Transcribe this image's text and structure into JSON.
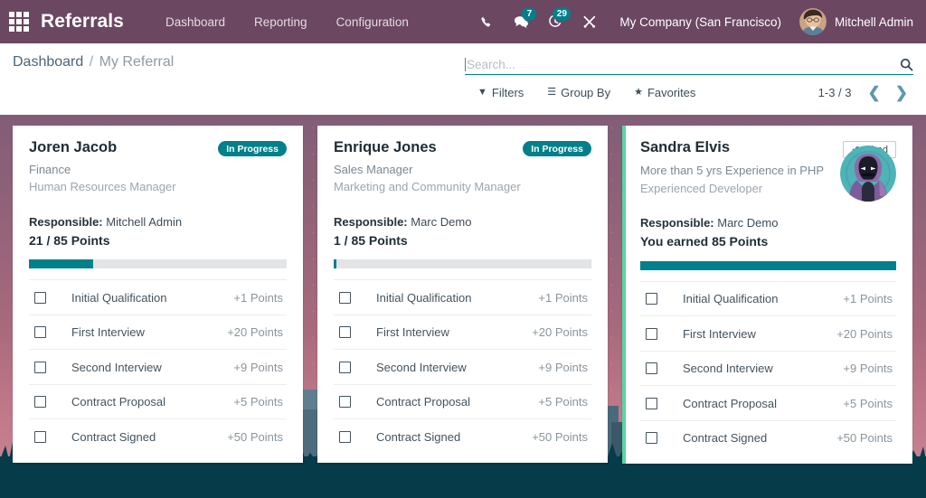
{
  "navbar": {
    "apps_icon": "apps-grid-icon",
    "brand": "Referrals",
    "menu": [
      {
        "label": "Dashboard"
      },
      {
        "label": "Reporting"
      },
      {
        "label": "Configuration"
      }
    ],
    "icons": [
      {
        "name": "phone-icon",
        "badge": null
      },
      {
        "name": "messages-icon",
        "badge": "7"
      },
      {
        "name": "activities-icon",
        "badge": "29"
      },
      {
        "name": "tools-icon",
        "badge": null
      }
    ],
    "company": "My Company (San Francisco)",
    "user": "Mitchell Admin"
  },
  "breadcrumb": {
    "root": "Dashboard",
    "separator": "/",
    "current": "My Referral"
  },
  "search": {
    "placeholder": "Search...",
    "value": ""
  },
  "controls": {
    "filters": "Filters",
    "group_by": "Group By",
    "favorites": "Favorites",
    "pager": "1-3 / 3",
    "prev": "❮",
    "next": "❯"
  },
  "colors": {
    "navbar": "#6b4761",
    "accent_teal": "#00808a",
    "hired_stripe": "#5ad4a0",
    "ground": "#063b4a"
  },
  "cards": [
    {
      "name": "Joren Jacob",
      "status": {
        "type": "in_progress",
        "label": "In Progress"
      },
      "subtitle1": "Finance",
      "subtitle2": "Human Resources Manager",
      "responsible_label": "Responsible:",
      "responsible_name": "Mitchell Admin",
      "points_text": "21 / 85 Points",
      "progress_percent": 25,
      "has_photo": false,
      "stages": [
        {
          "label": "Initial Qualification",
          "points": "+1 Points",
          "checked": false
        },
        {
          "label": "First Interview",
          "points": "+20 Points",
          "checked": false
        },
        {
          "label": "Second Interview",
          "points": "+9 Points",
          "checked": false
        },
        {
          "label": "Contract Proposal",
          "points": "+5 Points",
          "checked": false
        },
        {
          "label": "Contract Signed",
          "points": "+50 Points",
          "checked": false
        }
      ]
    },
    {
      "name": "Enrique Jones",
      "status": {
        "type": "in_progress",
        "label": "In Progress"
      },
      "subtitle1": "Sales Manager",
      "subtitle2": "Marketing and Community Manager",
      "responsible_label": "Responsible:",
      "responsible_name": "Marc Demo",
      "points_text": "1 / 85 Points",
      "progress_percent": 1.2,
      "has_photo": false,
      "stages": [
        {
          "label": "Initial Qualification",
          "points": "+1 Points",
          "checked": false
        },
        {
          "label": "First Interview",
          "points": "+20 Points",
          "checked": false
        },
        {
          "label": "Second Interview",
          "points": "+9 Points",
          "checked": false
        },
        {
          "label": "Contract Proposal",
          "points": "+5 Points",
          "checked": false
        },
        {
          "label": "Contract Signed",
          "points": "+50 Points",
          "checked": false
        }
      ]
    },
    {
      "name": "Sandra Elvis",
      "status": {
        "type": "hired",
        "label": "Hired",
        "check": "✔"
      },
      "subtitle1": "More than 5 yrs Experience in PHP",
      "subtitle2": "Experienced Developer",
      "responsible_label": "Responsible:",
      "responsible_name": "Marc Demo",
      "points_text": "You earned 85 Points",
      "progress_percent": 100,
      "has_photo": true,
      "photo_name": "candidate-avatar",
      "stages": [
        {
          "label": "Initial Qualification",
          "points": "+1 Points",
          "checked": false
        },
        {
          "label": "First Interview",
          "points": "+20 Points",
          "checked": false
        },
        {
          "label": "Second Interview",
          "points": "+9 Points",
          "checked": false
        },
        {
          "label": "Contract Proposal",
          "points": "+5 Points",
          "checked": false
        },
        {
          "label": "Contract Signed",
          "points": "+50 Points",
          "checked": false
        }
      ]
    }
  ]
}
